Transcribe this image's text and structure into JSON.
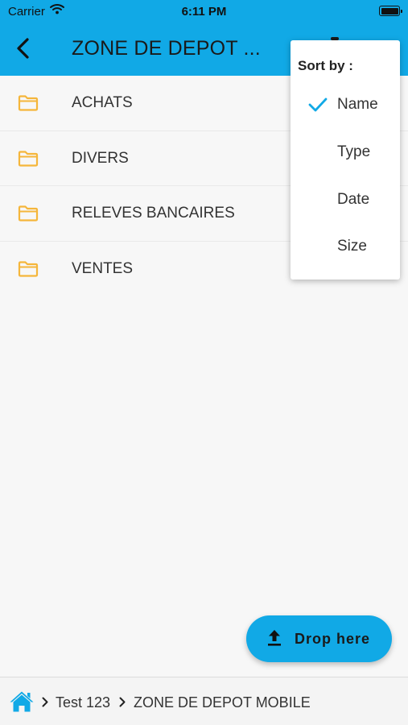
{
  "status_bar": {
    "carrier": "Carrier",
    "time": "6:11 PM"
  },
  "header": {
    "title": "ZONE DE DEPOT ..."
  },
  "folders": [
    {
      "name": "ACHATS"
    },
    {
      "name": "DIVERS"
    },
    {
      "name": "RELEVES BANCAIRES"
    },
    {
      "name": "VENTES"
    }
  ],
  "sort_menu": {
    "title": "Sort by :",
    "selected": "Name",
    "options": [
      "Name",
      "Type",
      "Date",
      "Size"
    ]
  },
  "fab": {
    "label": "Drop here"
  },
  "breadcrumb": {
    "items": [
      "Test 123",
      "ZONE DE DEPOT MOBILE"
    ]
  },
  "colors": {
    "accent": "#11a9e6",
    "folder": "#f5b63b",
    "background": "#f7f7f7"
  }
}
